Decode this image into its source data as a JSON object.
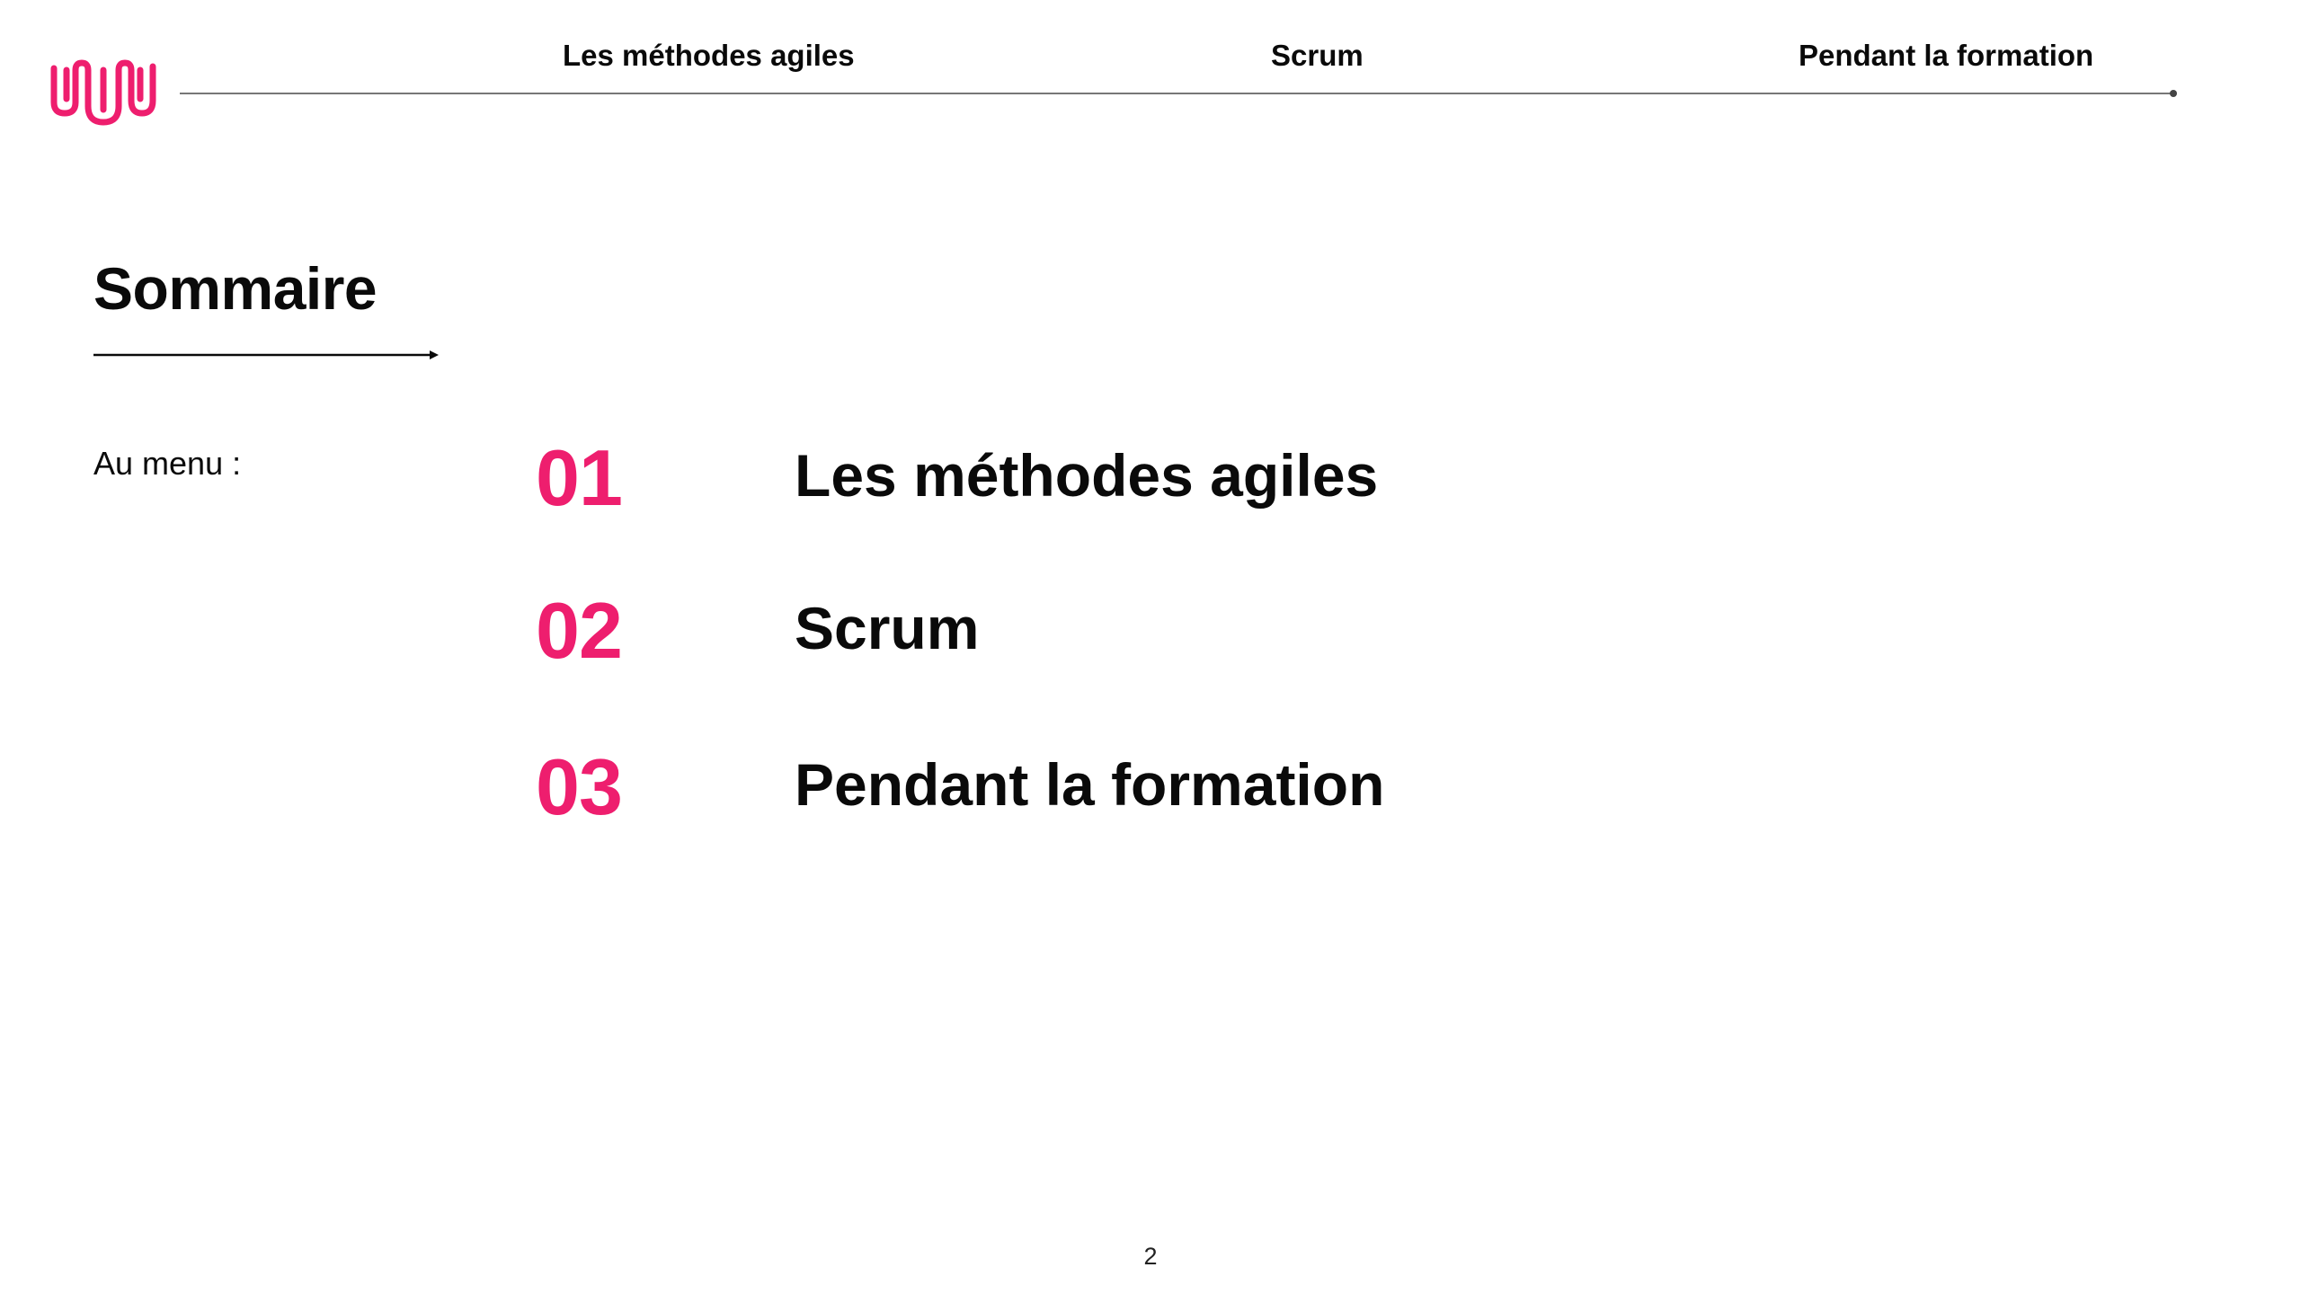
{
  "header": {
    "nav": [
      {
        "label": "Les méthodes agiles"
      },
      {
        "label": "Scrum"
      },
      {
        "label": "Pendant la formation"
      }
    ]
  },
  "main": {
    "title": "Sommaire",
    "subtitle": "Au menu :",
    "toc": [
      {
        "number": "01",
        "label": "Les méthodes agiles"
      },
      {
        "number": "02",
        "label": "Scrum"
      },
      {
        "number": "03",
        "label": "Pendant la formation"
      }
    ]
  },
  "footer": {
    "page_number": "2"
  },
  "colors": {
    "accent": "#ee1e6e",
    "text": "#0a0a0a",
    "rule": "#777777"
  },
  "icons": {
    "logo": "brand-logo-icon",
    "title_arrow": "arrow-right-icon"
  }
}
